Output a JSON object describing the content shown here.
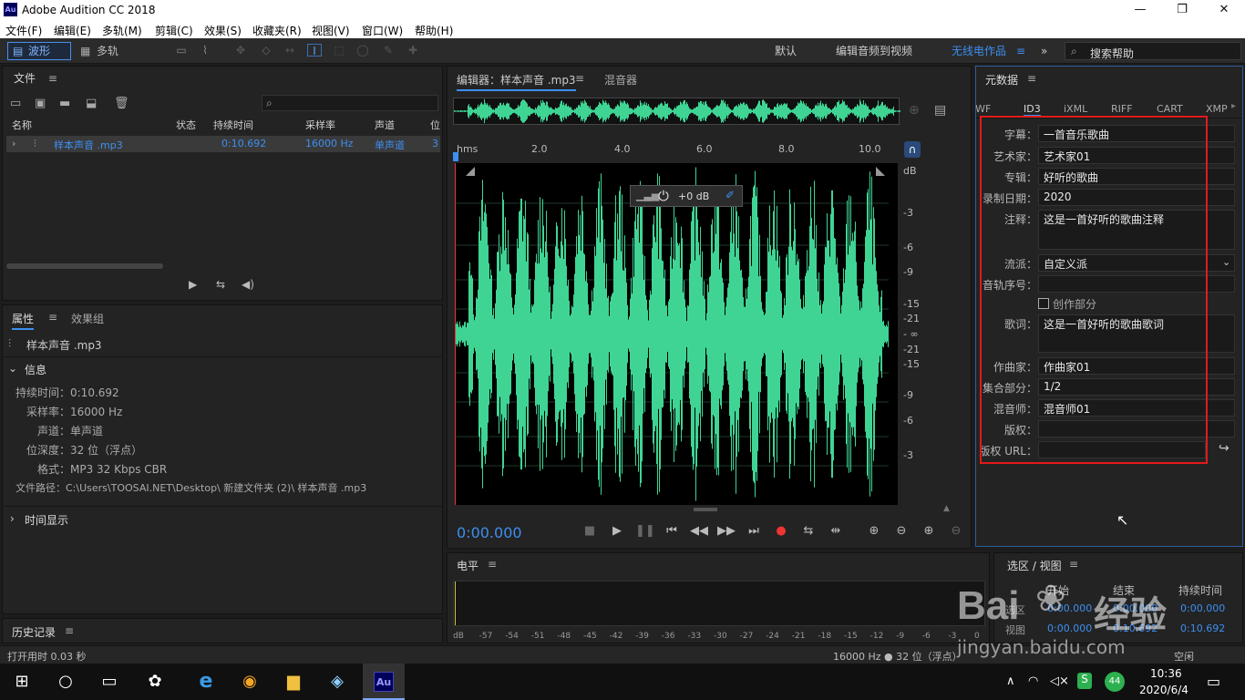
{
  "window": {
    "title": "Adobe Audition CC 2018",
    "logo": "Au",
    "minimize": "—",
    "maximize": "❐",
    "close": "✕"
  },
  "menu": [
    "文件(F)",
    "编辑(E)",
    "多轨(M)",
    "剪辑(C)",
    "效果(S)",
    "收藏夹(R)",
    "视图(V)",
    "窗口(W)",
    "帮助(H)"
  ],
  "toolbar": {
    "waveform": "波形",
    "multitrack": "多轨",
    "workspaces": [
      "默认",
      "编辑音频到视频",
      "无线电作品"
    ],
    "active_workspace": "无线电作品",
    "more": "»",
    "search_placeholder": "搜索帮助"
  },
  "files_panel": {
    "title": "文件",
    "columns": [
      "名称",
      "状态",
      "持续时间",
      "采样率",
      "声道",
      "位"
    ],
    "row": {
      "name": "样本声音 .mp3",
      "duration": "0:10.692",
      "rate": "16000 Hz",
      "channel": "单声道",
      "bits": "3"
    }
  },
  "properties_panel": {
    "tab_properties": "属性",
    "tab_effects": "效果组",
    "file": "样本声音 .mp3",
    "section_info": "信息",
    "info": [
      "持续时间：0:10.692",
      "采样率：16000 Hz",
      "声道：单声道",
      "位深度：32 位（浮点）",
      "格式：MP3 32 Kbps CBR",
      "文件路径：C:\\Users\\TOOSAI.NET\\Desktop\\ 新建文件夹 (2)\\ 样本声音 .mp3"
    ],
    "section_time": "时间显示"
  },
  "history_panel": {
    "title": "历史记录"
  },
  "status": {
    "left": "打开用时 0.03 秒",
    "right": "16000 Hz ● 32 位（浮点）",
    "free": "空闲"
  },
  "editor": {
    "tab": "编辑器：样本声音 .mp3",
    "tab_mixer": "混音器",
    "ruler": [
      "hms",
      "2.0",
      "4.0",
      "6.0",
      "8.0",
      "10.0"
    ],
    "db_scale": [
      "dB",
      "-3",
      "-6",
      "-9",
      "-15",
      "-21",
      "- ∞",
      "-21",
      "-15",
      "-9",
      "-6",
      "-3"
    ],
    "hud_gain": "+0 dB",
    "time": "0:00.000",
    "waveform_color": "#3fd494"
  },
  "level_panel": {
    "title": "电平",
    "scale": [
      "dB",
      "-57",
      "-54",
      "-51",
      "-48",
      "-45",
      "-42",
      "-39",
      "-36",
      "-33",
      "-30",
      "-27",
      "-24",
      "-21",
      "-18",
      "-15",
      "-12",
      "-9",
      "-6",
      "-3",
      "0"
    ]
  },
  "selection_panel": {
    "title": "选区 / 视图",
    "headers": [
      "开始",
      "结束",
      "持续时间"
    ],
    "rows": [
      {
        "label": "选区",
        "start": "0:00.000",
        "end": "0:00.000",
        "dur": "0:00.000"
      },
      {
        "label": "视图",
        "start": "0:00.000",
        "end": "0:10.692",
        "dur": "0:10.692"
      }
    ]
  },
  "metadata_panel": {
    "title": "元数据",
    "tabs": [
      "BWF",
      "ID3",
      "iXML",
      "RIFF",
      "CART",
      "XMP"
    ],
    "active_tab": "ID3",
    "fields": {
      "title_label": "字幕：",
      "title": "一首音乐歌曲",
      "artist_label": "艺术家：",
      "artist": "艺术家01",
      "album_label": "专辑：",
      "album": "好听的歌曲",
      "date_label": "录制日期：",
      "date": "2020",
      "comment_label": "注释：",
      "comment": "这是一首好听的歌曲注释",
      "genre_label": "流派：",
      "genre": "自定义派",
      "track_label": "音轨序号：",
      "track": "",
      "part_label": "创作部分",
      "lyrics_label": "歌词：",
      "lyrics": "这是一首好听的歌曲歌词",
      "composer_label": "作曲家：",
      "composer": "作曲家01",
      "set_label": "集合部分：",
      "set": "1/2",
      "mixer_label": "混音师：",
      "mixer": "混音师01",
      "copyright_label": "版权：",
      "copyright": "",
      "url_label": "版权 URL：",
      "url": ""
    },
    "highlight_color": "#e31a1a"
  },
  "watermark": {
    "brand": "Bai",
    "brand2": "经验",
    "url": "jingyan.baidu.com"
  },
  "taskbar": {
    "time": "10:36",
    "date": "2020/6/4",
    "badge": "44"
  }
}
